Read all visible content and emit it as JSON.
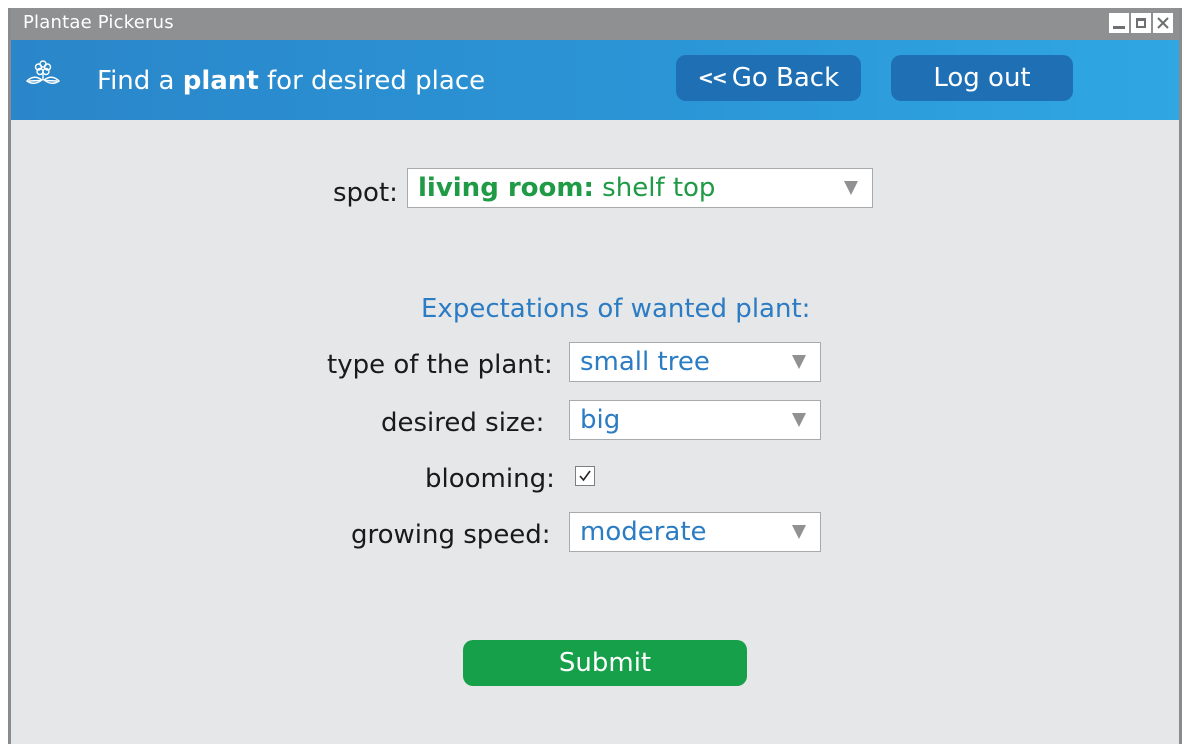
{
  "window": {
    "title": "Plantae Pickerus"
  },
  "header": {
    "title_prefix": "Find a ",
    "title_bold": "plant",
    "title_suffix": " for desired place",
    "back_chevron": "<<",
    "back_label": "Go Back",
    "logout_label": "Log out",
    "logo_icon": "flower-leaves-icon"
  },
  "form": {
    "spot_label": "spot:",
    "spot_value_bold": "living room:",
    "spot_value_rest": " shelf top",
    "section_title": "Expectations of wanted plant:",
    "type_label": "type of the plant:",
    "type_value": "small tree",
    "size_label": "desired size:",
    "size_value": "big",
    "blooming_label": "blooming:",
    "blooming_checked": true,
    "speed_label": "growing speed:",
    "speed_value": "moderate",
    "submit_label": "Submit"
  },
  "colors": {
    "header_start": "#2a86c9",
    "header_end": "#2fa7e2",
    "header_button": "#1f6fb5",
    "submit": "#17a04a",
    "value_blue": "#2b7cc3",
    "spot_green": "#1f9a45",
    "background": "#e6e7e9"
  }
}
